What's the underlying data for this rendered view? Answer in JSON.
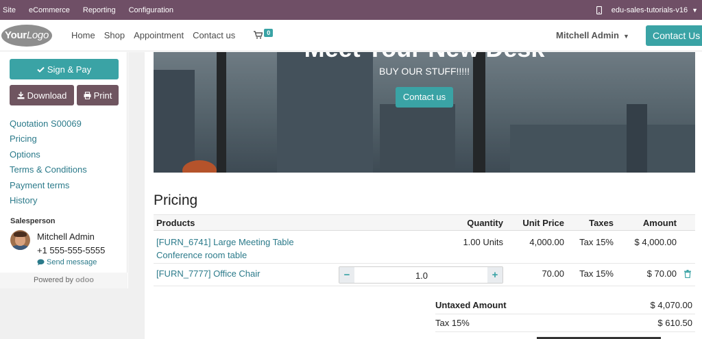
{
  "adminbar": {
    "items": [
      "Site",
      "eCommerce",
      "Reporting",
      "Configuration"
    ],
    "database": "edu-sales-tutorials-v16"
  },
  "navbar": {
    "logo_bold": "Your",
    "logo_rest": "Logo",
    "links": [
      "Home",
      "Shop",
      "Appointment",
      "Contact us"
    ],
    "cart_count": "0",
    "user": "Mitchell Admin",
    "contact_button": "Contact Us"
  },
  "sidebar": {
    "sign_pay": "Sign & Pay",
    "download": "Download",
    "print": "Print",
    "toc": [
      "Quotation S00069",
      "Pricing",
      "Options",
      "Terms & Conditions",
      "Payment terms",
      "History"
    ],
    "salesperson_heading": "Salesperson",
    "salesperson_name": "Mitchell Admin",
    "salesperson_phone": "+1 555-555-5555",
    "send_message": "Send message",
    "powered_by": "Powered by",
    "powered_brand": "odoo"
  },
  "hero": {
    "title_fragment": "Meet Your New Desk",
    "tagline": "BUY OUR STUFF!!!!!",
    "button": "Contact us"
  },
  "pricing": {
    "title": "Pricing",
    "headers": {
      "products": "Products",
      "quantity": "Quantity",
      "unit_price": "Unit Price",
      "taxes": "Taxes",
      "amount": "Amount"
    },
    "rows": [
      {
        "product": "[FURN_6741] Large Meeting Table",
        "description": "Conference room table",
        "quantity": "1.00 Units",
        "unit_price": "4,000.00",
        "taxes": "Tax 15%",
        "amount": "$ 4,000.00"
      },
      {
        "product": "[FURN_7777] Office Chair",
        "quantity_value": "1.0",
        "unit_price": "70.00",
        "taxes": "Tax 15%",
        "amount": "$ 70.00"
      }
    ],
    "stepper_minus": "−",
    "stepper_plus": "+"
  },
  "totals": {
    "untaxed_label": "Untaxed Amount",
    "untaxed_value": "$ 4,070.00",
    "tax_label": "Tax 15%",
    "tax_value": "$ 610.50"
  },
  "colors": {
    "admin_bar": "#6f4f66",
    "accent": "#3aa3a5",
    "secondary_button": "#6f5560",
    "link": "#2b7a8a"
  }
}
